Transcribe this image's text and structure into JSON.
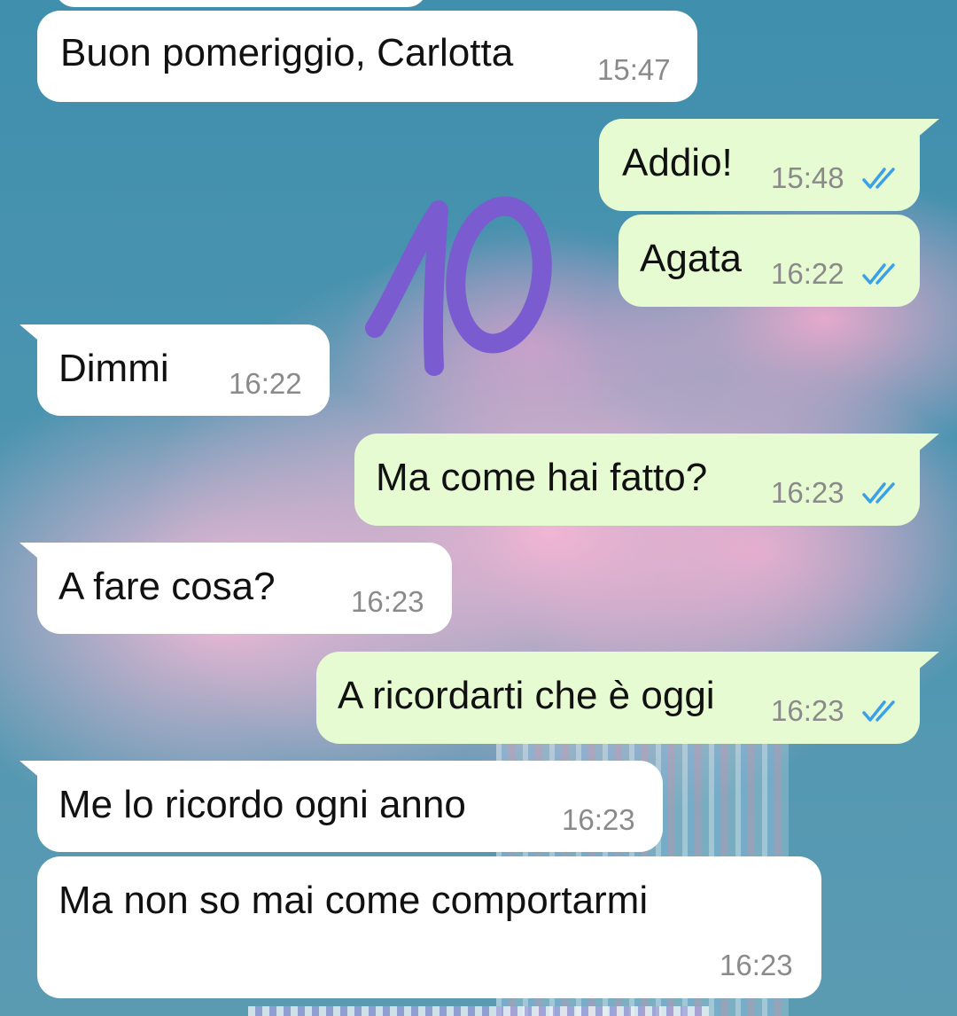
{
  "chat": {
    "messages": [
      {
        "type": "in",
        "text": "Buon pomeriggio, Carlotta",
        "time": "15:47"
      },
      {
        "type": "out",
        "text": "Addio!",
        "time": "15:48",
        "read": true
      },
      {
        "type": "out",
        "text": "Agata",
        "time": "16:22",
        "read": true
      },
      {
        "type": "in",
        "text": "Dimmi",
        "time": "16:22"
      },
      {
        "type": "out",
        "text": "Ma come hai fatto?",
        "time": "16:23",
        "read": true
      },
      {
        "type": "in",
        "text": "A fare cosa?",
        "time": "16:23"
      },
      {
        "type": "out",
        "text": "A ricordarti che è oggi",
        "time": "16:23",
        "read": true
      },
      {
        "type": "in",
        "text": "Me lo ricordo ogni anno",
        "time": "16:23"
      },
      {
        "type": "in",
        "text": "Ma non so mai come comportarmi",
        "time": "16:23"
      }
    ]
  },
  "wallpaper": {
    "doodle_text": "10",
    "doodle_color": "#7a5bd0"
  },
  "colors": {
    "incoming_bubble": "#ffffff",
    "outgoing_bubble": "#e6fbd2",
    "read_ticks": "#3aa0e8",
    "timestamp": "#8a8a8a"
  },
  "icons": {
    "read_receipt": "double-check-icon"
  }
}
